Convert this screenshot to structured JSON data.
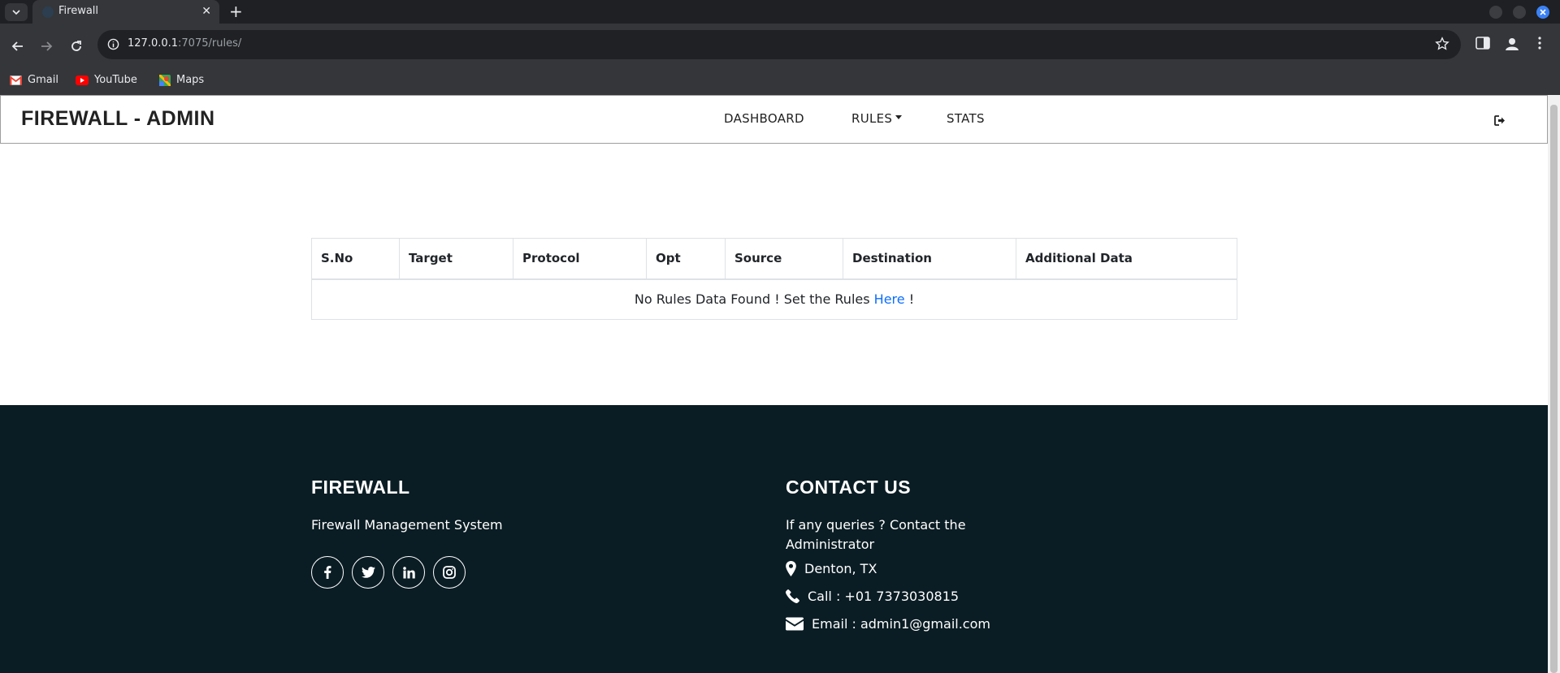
{
  "browser": {
    "tab_title": "Firewall",
    "url_host": "127.0.0.1",
    "url_path": ":7075/rules/",
    "bookmarks": [
      {
        "label": "Gmail",
        "icon": "gmail-icon"
      },
      {
        "label": "YouTube",
        "icon": "youtube-icon"
      },
      {
        "label": "Maps",
        "icon": "maps-icon"
      }
    ]
  },
  "navbar": {
    "brand": "FIREWALL - ADMIN",
    "links": [
      "DASHBOARD",
      "RULES",
      "STATS"
    ]
  },
  "table": {
    "headers": [
      "S.No",
      "Target",
      "Protocol",
      "Opt",
      "Source",
      "Destination",
      "Additional Data"
    ],
    "empty_message": "No Rules Data Found ! Set the Rules ",
    "empty_link": "Here",
    "empty_suffix": " !"
  },
  "footer": {
    "left_heading": "FIREWALL",
    "left_text": "Firewall Management System",
    "right_heading": "CONTACT US",
    "right_text_line1": "If any queries ? Contact the",
    "right_text_line2": "Administrator",
    "location": "Denton, TX",
    "phone": "Call : +01 7373030815",
    "email": "Email : admin1@gmail.com"
  },
  "colors": {
    "footer_bg": "#0b1d24",
    "link": "#0d6efd",
    "browser_dark": "#35363a"
  }
}
